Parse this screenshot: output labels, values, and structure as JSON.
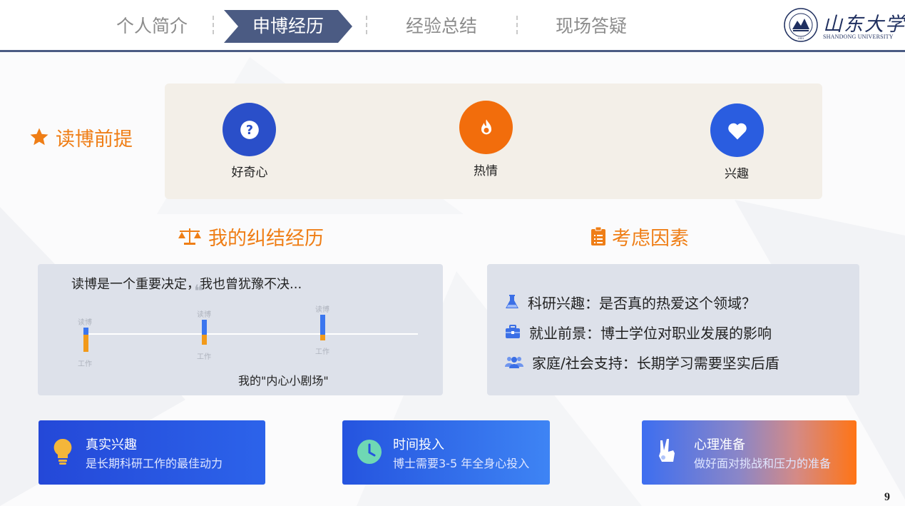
{
  "nav": {
    "items": [
      {
        "label": "个人简介",
        "active": false
      },
      {
        "label": "申博经历",
        "active": true
      },
      {
        "label": "经验总结",
        "active": false
      },
      {
        "label": "现场答疑",
        "active": false
      }
    ],
    "active_color": "#4b5b83"
  },
  "logo": {
    "name_cn": "山东大学",
    "name_en": "SHANDONG UNIVERSITY",
    "seal_text": "SHANDONG UNIVERSITY",
    "seal_year": "1901"
  },
  "premise": {
    "title": "读博前提",
    "title_icon": "star-icon",
    "items": [
      {
        "label": "好奇心",
        "icon": "question-icon",
        "color": "#2a4fc9"
      },
      {
        "label": "热情",
        "icon": "fire-icon",
        "color": "#f26d0c"
      },
      {
        "label": "兴趣",
        "icon": "heart-icon",
        "color": "#2a5de0"
      }
    ]
  },
  "struggle": {
    "title": "我的纠结经历",
    "title_icon": "scale-icon",
    "quote": "读博是一个重要决定，我也曾犹豫不决...",
    "quote_mark": "❝",
    "timeline_label_top": "读博",
    "timeline_label_bottom": "工作",
    "caption": "我的\"内心小剧场\""
  },
  "factors": {
    "title": "考虑因素",
    "title_icon": "clipboard-icon",
    "items": [
      {
        "icon": "flask-icon",
        "text": "科研兴趣：是否真的热爱这个领域？"
      },
      {
        "icon": "briefcase-icon",
        "text": "就业前景：博士学位对职业发展的影响"
      },
      {
        "icon": "users-icon",
        "text": "家庭/社会支持：长期学习需要坚实后盾"
      }
    ]
  },
  "cards": [
    {
      "title": "真实兴趣",
      "subtitle": "是长期科研工作的最佳动力",
      "icon": "lightbulb-icon"
    },
    {
      "title": "时间投入",
      "subtitle": "博士需要3-5 年全身心投入",
      "icon": "clock-icon"
    },
    {
      "title": "心理准备",
      "subtitle": "做好面对挑战和压力的准备",
      "icon": "peace-hand-icon"
    }
  ],
  "colors": {
    "accent": "#ef7e16",
    "blue": "#2a5de0",
    "panel_gray": "#dde1ea",
    "panel_beige": "#f3efe8"
  },
  "page_number": "9"
}
